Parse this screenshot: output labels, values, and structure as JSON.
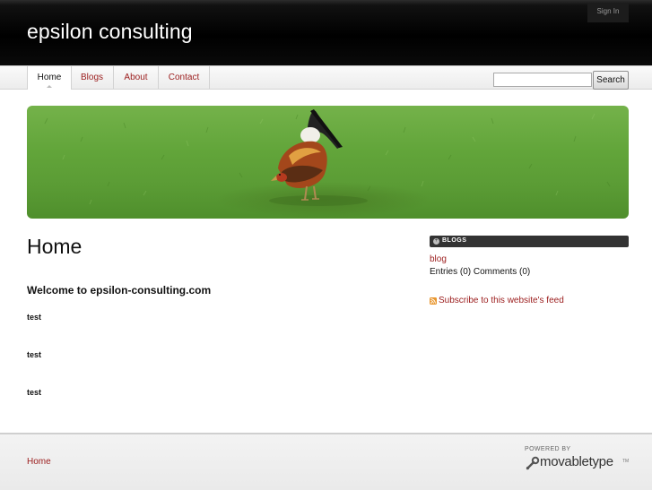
{
  "header": {
    "site_title": "epsilon consulting",
    "signin_label": "Sign In"
  },
  "nav": {
    "tabs": [
      {
        "label": "Home",
        "active": true
      },
      {
        "label": "Blogs",
        "active": false
      },
      {
        "label": "About",
        "active": false
      },
      {
        "label": "Contact",
        "active": false
      }
    ]
  },
  "search": {
    "value": "",
    "button_label": "Search"
  },
  "banner": {
    "image": "rooster-on-grass"
  },
  "main": {
    "page_title": "Home",
    "welcome": "Welcome to epsilon-consulting.com",
    "entries": [
      "test",
      "test",
      "test"
    ]
  },
  "sidebar": {
    "widget_title": "BLOGS",
    "blog_link": "blog",
    "blog_stats": "Entries (0) Comments (0)",
    "feed_link": "Subscribe to this website's feed"
  },
  "footer": {
    "home_link": "Home",
    "powered_by": "POWERED BY",
    "logo_text": "movabletype",
    "logo_tm": "TM"
  },
  "colors": {
    "link": "#9b1c1c",
    "header_bg": "#000000",
    "grass": "#62a53a"
  }
}
